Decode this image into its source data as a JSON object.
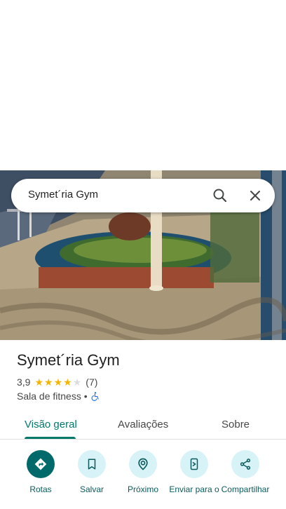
{
  "search": {
    "query": "Symet´ria Gym"
  },
  "place": {
    "name": "Symet´ria Gym",
    "rating": "3,9",
    "stars": 3.9,
    "reviews": "(7)",
    "category": "Sala de fitness •"
  },
  "tabs": [
    {
      "label": "Visão geral"
    },
    {
      "label": "Avaliações"
    },
    {
      "label": "Sobre"
    }
  ],
  "actions": [
    {
      "label": "Rotas",
      "icon": "directions-icon"
    },
    {
      "label": "Salvar",
      "icon": "bookmark-icon"
    },
    {
      "label": "Próximo",
      "icon": "nearby-icon"
    },
    {
      "label": "Enviar para o",
      "icon": "send-to-phone-icon"
    },
    {
      "label": "Compartilhar",
      "icon": "share-icon"
    }
  ],
  "colors": {
    "accent": "#00796b",
    "action_bg": "#d7f3f8",
    "primary_action": "#006a6a",
    "star": "#f5b400"
  }
}
